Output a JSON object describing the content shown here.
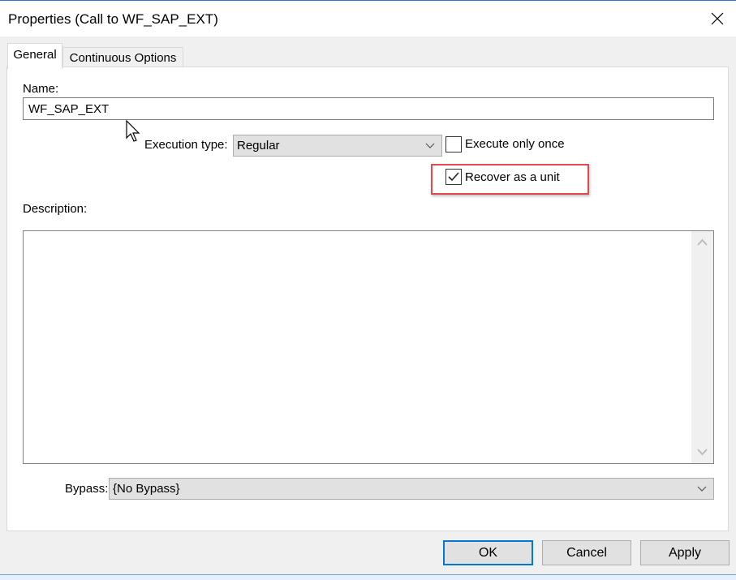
{
  "window": {
    "title": "Properties (Call to WF_SAP_EXT)",
    "close_icon": "close-icon"
  },
  "tabs": [
    {
      "label": "General",
      "active": true
    },
    {
      "label": "Continuous Options",
      "active": false
    }
  ],
  "general": {
    "name_label": "Name:",
    "name_value": "WF_SAP_EXT",
    "execution_type_label": "Execution type:",
    "execution_type_value": "Regular",
    "execute_only_once_label": "Execute only once",
    "execute_only_once_checked": false,
    "recover_as_unit_label": "Recover as a unit",
    "recover_as_unit_checked": true,
    "description_label": "Description:",
    "description_value": "",
    "bypass_label": "Bypass:",
    "bypass_value": "{No Bypass}"
  },
  "buttons": {
    "ok": "OK",
    "cancel": "Cancel",
    "apply": "Apply"
  },
  "colors": {
    "highlight": "#e04a4f",
    "default_button_border": "#0078d7",
    "accent": "#2b79c2"
  }
}
